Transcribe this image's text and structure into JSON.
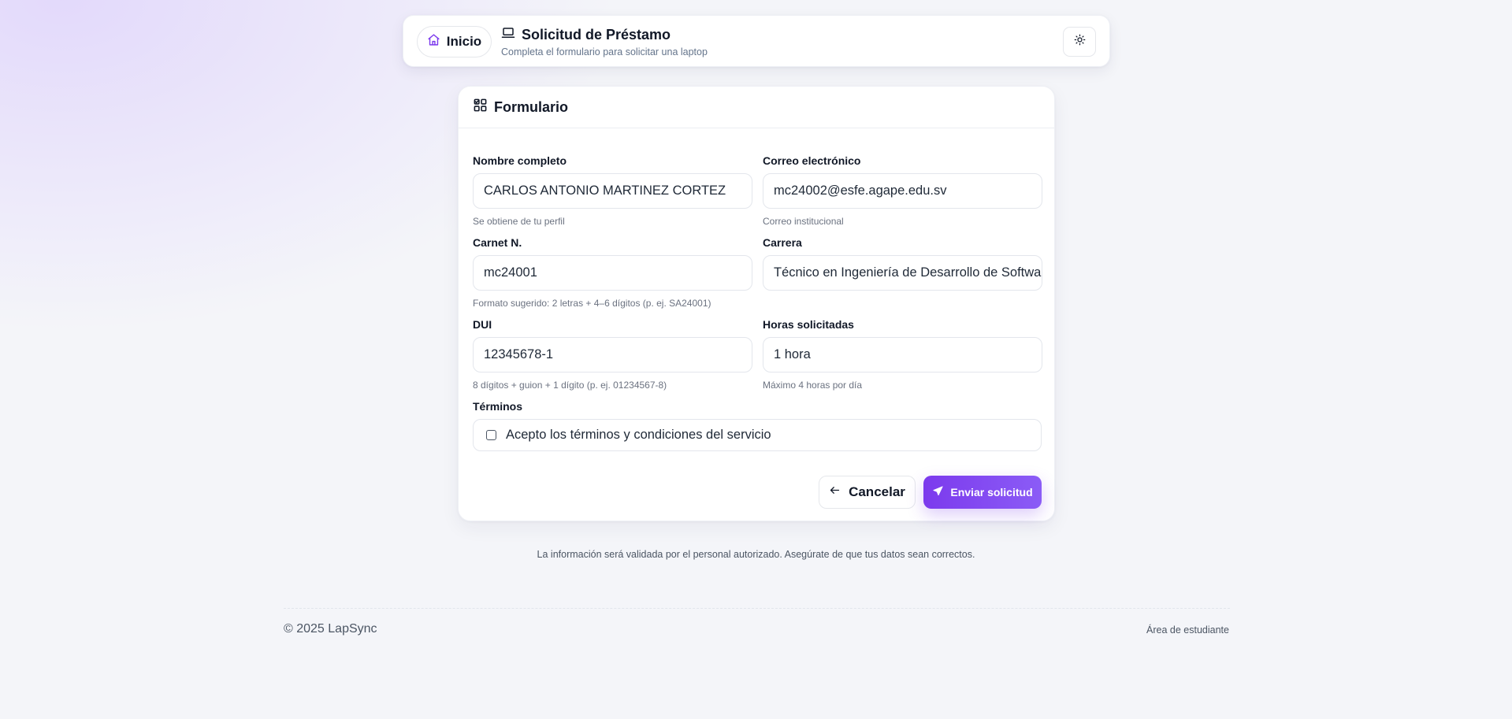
{
  "header": {
    "home_label": "Inicio",
    "title": "Solicitud de Préstamo",
    "subtitle": "Completa el formulario para solicitar una laptop"
  },
  "form": {
    "title": "Formulario",
    "fields": {
      "nombre": {
        "label": "Nombre completo",
        "value": "CARLOS ANTONIO MARTINEZ CORTEZ",
        "hint": "Se obtiene de tu perfil"
      },
      "correo": {
        "label": "Correo electrónico",
        "value": "mc24002@esfe.agape.edu.sv",
        "hint": "Correo institucional"
      },
      "carnet": {
        "label": "Carnet N.",
        "value": "mc24001",
        "hint": "Formato sugerido: 2 letras + 4–6 dígitos (p. ej. SA24001)"
      },
      "carrera": {
        "label": "Carrera",
        "value": "Técnico en Ingeniería de Desarrollo de Software"
      },
      "dui": {
        "label": "DUI",
        "value": "12345678-1",
        "hint": "8 dígitos + guion + 1 dígito (p. ej. 01234567-8)"
      },
      "horas": {
        "label": "Horas solicitadas",
        "value": "1 hora",
        "hint": "Máximo 4 horas por día"
      }
    },
    "terms": {
      "label": "Términos",
      "text": "Acepto los términos y condiciones del servicio",
      "checked": false
    },
    "cancel_label": "Cancelar",
    "submit_label": "Enviar solicitud"
  },
  "note": "La información será validada por el personal autorizado. Asegúrate de que tus datos sean correctos.",
  "footer": {
    "copyright": "© 2025 LapSync",
    "area": "Área de estudiante"
  },
  "colors": {
    "accent": "#7c3aed",
    "accent_light": "#8b5cf6",
    "background": "#f4f5f9"
  },
  "icons": {
    "home": "home-icon",
    "laptop": "laptop-icon",
    "theme": "sun-icon",
    "form": "form-grid-icon",
    "cancel": "arrow-left-icon",
    "send": "send-icon"
  }
}
